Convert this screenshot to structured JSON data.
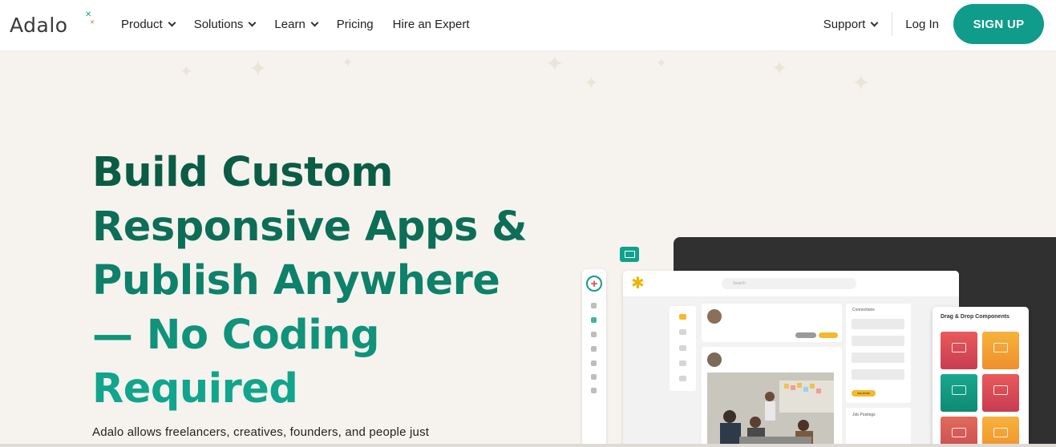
{
  "brand": {
    "name": "Adalo",
    "accent": "#0f9c8b",
    "title_gradient": [
      "#0a5c45",
      "#10a58c"
    ]
  },
  "nav": {
    "items": [
      {
        "label": "Product",
        "dropdown": true
      },
      {
        "label": "Solutions",
        "dropdown": true
      },
      {
        "label": "Learn",
        "dropdown": true
      },
      {
        "label": "Pricing",
        "dropdown": false
      },
      {
        "label": "Hire an Expert",
        "dropdown": false
      }
    ],
    "support": "Support",
    "login": "Log In",
    "signup": "SIGN UP"
  },
  "hero": {
    "title_lines": [
      "Build Custom",
      "Responsive Apps &",
      "Publish Anywhere",
      "— No Coding",
      "Required"
    ],
    "subtitle": "Adalo allows freelancers, creatives, founders, and people just"
  },
  "mockup": {
    "search_placeholder": "Search",
    "connections_title": "Connections",
    "see_more": "SEE MORE",
    "jobs_title": "Job Postings",
    "dnd_title": "Drag & Drop Components"
  }
}
